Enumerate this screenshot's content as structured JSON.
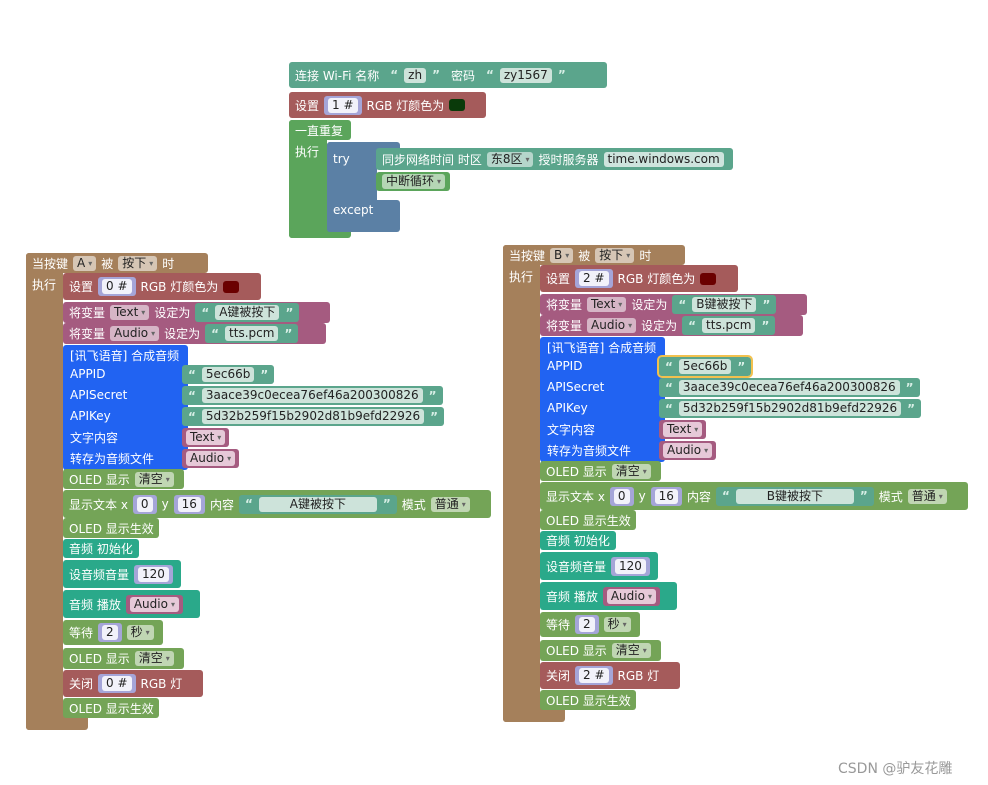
{
  "colors": {
    "wifi": "#5ba58c",
    "rgb": "#a55b5b",
    "loop": "#5ba55b",
    "try": "#5b80a5",
    "event": "#a5805b",
    "variable": "#a55b80",
    "xunfei": "#2163f2",
    "oled": "#74a457",
    "audio": "#2aa98a"
  },
  "top": {
    "wifi": {
      "label": "连接 Wi-Fi 名称",
      "ssid": "zh",
      "pwd_label": "密码",
      "pwd": "zy1567"
    },
    "rgb": {
      "label": "设置",
      "led": "1 #",
      "rgb_label": "RGB 灯颜色为",
      "color": "#0a3a0a"
    },
    "loop": {
      "label": "一直重复",
      "do": "执行"
    },
    "try": {
      "try": "try",
      "except": "except"
    },
    "sync": {
      "label": "同步网络时间 时区",
      "tz": "东8区",
      "server_label": "授时服务器",
      "server": "time.windows.com"
    },
    "break": "中断循环"
  },
  "left": {
    "event": {
      "when": "当按键",
      "key": "A",
      "by": "被",
      "action": "按下",
      "time": "时",
      "do": "执行"
    },
    "rgb": {
      "label": "设置",
      "led": "0 #",
      "rgb_label": "RGB 灯颜色为",
      "color": "#6b0000"
    },
    "var_text": {
      "label": "将变量",
      "var": "Text",
      "set": "设定为",
      "value": "A键被按下"
    },
    "var_audio": {
      "label": "将变量",
      "var": "Audio",
      "set": "设定为",
      "value": "tts.pcm"
    },
    "xunfei": {
      "title": "[讯飞语音] 合成音频",
      "appid_label": "APPID",
      "appid": "5ec66b",
      "secret_label": "APISecret",
      "secret": "3aace39c0ecea76ef46a200300826",
      "key_label": "APIKey",
      "key": "5d32b259f15b2902d81b9efd22926",
      "text_label": "文字内容",
      "text_var": "Text",
      "file_label": "转存为音频文件",
      "file_var": "Audio"
    },
    "oled_clear": {
      "label": "OLED 显示",
      "mode": "清空"
    },
    "show_text": {
      "label": "显示文本 x",
      "x": "0",
      "y_label": "y",
      "y": "16",
      "content_label": "内容",
      "content": "A键被按下",
      "mode_label": "模式",
      "mode": "普通"
    },
    "oled_apply": "OLED 显示生效",
    "audio_init": "音频 初始化",
    "volume": {
      "label": "设音频音量",
      "value": "120"
    },
    "play": {
      "label": "音频 播放",
      "var": "Audio"
    },
    "wait": {
      "label": "等待",
      "value": "2",
      "unit": "秒"
    },
    "oled_clear2": {
      "label": "OLED 显示",
      "mode": "清空"
    },
    "rgb_off": {
      "label": "关闭",
      "led": "0 #",
      "rgb_label": "RGB 灯"
    },
    "oled_apply2": "OLED 显示生效"
  },
  "right": {
    "event": {
      "when": "当按键",
      "key": "B",
      "by": "被",
      "action": "按下",
      "time": "时",
      "do": "执行"
    },
    "rgb": {
      "label": "设置",
      "led": "2 #",
      "rgb_label": "RGB 灯颜色为",
      "color": "#6b0000"
    },
    "var_text": {
      "label": "将变量",
      "var": "Text",
      "set": "设定为",
      "value": "B键被按下"
    },
    "var_audio": {
      "label": "将变量",
      "var": "Audio",
      "set": "设定为",
      "value": "tts.pcm"
    },
    "xunfei": {
      "title": "[讯飞语音] 合成音频",
      "appid_label": "APPID",
      "appid": "5ec66b",
      "secret_label": "APISecret",
      "secret": "3aace39c0ecea76ef46a200300826",
      "key_label": "APIKey",
      "key": "5d32b259f15b2902d81b9efd22926",
      "text_label": "文字内容",
      "text_var": "Text",
      "file_label": "转存为音频文件",
      "file_var": "Audio"
    },
    "oled_clear": {
      "label": "OLED 显示",
      "mode": "清空"
    },
    "show_text": {
      "label": "显示文本 x",
      "x": "0",
      "y_label": "y",
      "y": "16",
      "content_label": "内容",
      "content": "B键被按下",
      "mode_label": "模式",
      "mode": "普通"
    },
    "oled_apply": "OLED 显示生效",
    "audio_init": "音频 初始化",
    "volume": {
      "label": "设音频音量",
      "value": "120"
    },
    "play": {
      "label": "音频 播放",
      "var": "Audio"
    },
    "wait": {
      "label": "等待",
      "value": "2",
      "unit": "秒"
    },
    "oled_clear2": {
      "label": "OLED 显示",
      "mode": "清空"
    },
    "rgb_off": {
      "label": "关闭",
      "led": "2 #",
      "rgb_label": "RGB 灯"
    },
    "oled_apply2": "OLED 显示生效"
  },
  "watermark": "CSDN @驴友花雕"
}
